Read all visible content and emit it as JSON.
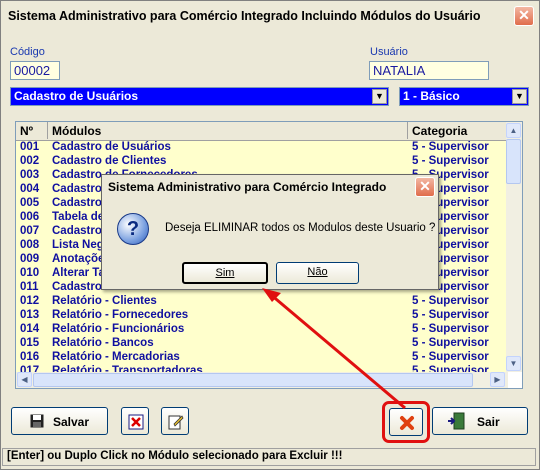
{
  "window": {
    "title": "Sistema Administrativo para Comércio Integrado Incluindo Módulos do Usuário",
    "close_glyph": "✕"
  },
  "form": {
    "codigo_label": "Código",
    "codigo_value": "00002",
    "usuario_label": "Usuário",
    "usuario_value": "NATALIA",
    "modulo_combo_value": "Cadastro de Usuários",
    "nivel_combo_value": "1 - Básico"
  },
  "grid": {
    "columns": [
      "Nº",
      "Módulos",
      "Categoria"
    ],
    "rows": [
      {
        "n": "001",
        "modulo": "Cadastro de Usuários",
        "categoria": "5 - Supervisor"
      },
      {
        "n": "002",
        "modulo": "Cadastro de Clientes",
        "categoria": "5 - Supervisor"
      },
      {
        "n": "003",
        "modulo": "Cadastro de Fornecedores",
        "categoria": "5 - Supervisor"
      },
      {
        "n": "004",
        "modulo": "Cadastro de Funcionários",
        "categoria": "5 - Supervisor"
      },
      {
        "n": "005",
        "modulo": "Cadastro de Bancos",
        "categoria": "5 - Supervisor"
      },
      {
        "n": "006",
        "modulo": "Tabela de Mercadorias",
        "categoria": "5 - Supervisor"
      },
      {
        "n": "007",
        "modulo": "Cadastro de Transportadoras",
        "categoria": "5 - Supervisor"
      },
      {
        "n": "008",
        "modulo": "Lista Negra",
        "categoria": "5 - Supervisor"
      },
      {
        "n": "009",
        "modulo": "Anotações",
        "categoria": "5 - Supervisor"
      },
      {
        "n": "010",
        "modulo": "Alterar Tabela",
        "categoria": "5 - Supervisor"
      },
      {
        "n": "011",
        "modulo": "Cadastro de Cidades",
        "categoria": "5 - Supervisor"
      },
      {
        "n": "012",
        "modulo": "Relatório - Clientes",
        "categoria": "5 - Supervisor"
      },
      {
        "n": "013",
        "modulo": "Relatório - Fornecedores",
        "categoria": "5 - Supervisor"
      },
      {
        "n": "014",
        "modulo": "Relatório - Funcionários",
        "categoria": "5 - Supervisor"
      },
      {
        "n": "015",
        "modulo": "Relatório - Bancos",
        "categoria": "5 - Supervisor"
      },
      {
        "n": "016",
        "modulo": "Relatório - Mercadorias",
        "categoria": "5 - Supervisor"
      },
      {
        "n": "017",
        "modulo": "Relatório - Transportadoras",
        "categoria": "5 - Supervisor"
      }
    ]
  },
  "toolbar": {
    "salvar_label": "Salvar",
    "sair_label": "Sair"
  },
  "status_text": "[Enter] ou Duplo Click no Módulo selecionado para Excluir !!!",
  "dialog": {
    "title": "Sistema Administrativo para Comércio Integrado",
    "message": "Deseja ELIMINAR todos os Modulos deste Usuario ?",
    "question_glyph": "?",
    "yes_label": "Sim",
    "no_label": "Não"
  },
  "colors": {
    "field_bg": "#ffffe1",
    "combo_bg": "#0000ff",
    "label_blue": "#1a39b0",
    "row_bg": "#ffffcc",
    "highlight_red": "#e01010"
  },
  "icons": [
    "close-icon",
    "save-icon",
    "delete-module-icon",
    "edit-icon",
    "delete-all-icon",
    "exit-door-icon",
    "question-icon",
    "arrow-annotation"
  ]
}
